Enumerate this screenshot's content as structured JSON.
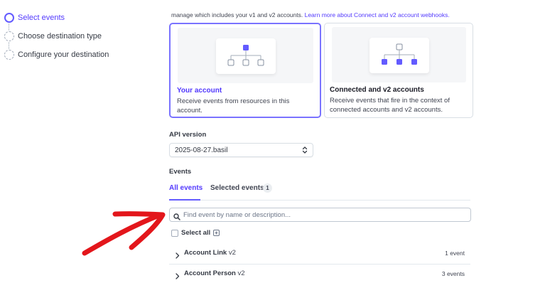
{
  "stepper": {
    "steps": [
      {
        "label": "Select events",
        "active": true
      },
      {
        "label": "Choose destination type",
        "active": false
      },
      {
        "label": "Configure your destination",
        "active": false
      }
    ]
  },
  "intro": {
    "text": "manage which includes your v1 and v2 accounts. ",
    "link": "Learn more about Connect and v2 account webhooks."
  },
  "cards": [
    {
      "title": "Your account",
      "description": "Receive events from resources in this account.",
      "selected": true
    },
    {
      "title": "Connected and v2 accounts",
      "description": "Receive events that fire in the context of connected accounts and v2 accounts.",
      "selected": false
    }
  ],
  "api": {
    "label": "API version",
    "value": "2025-08-27.basil"
  },
  "events": {
    "label": "Events",
    "tabs": {
      "all": "All events",
      "selected": "Selected events",
      "selected_count": "1"
    },
    "search_placeholder": "Find event by name or description...",
    "select_all": "Select all",
    "rows": [
      {
        "name": "Account Link",
        "version": "v2",
        "count": "1 event"
      },
      {
        "name": "Account Person",
        "version": "v2",
        "count": "3 events"
      }
    ]
  },
  "colors": {
    "accent": "#635bff",
    "annotation": "#e3161b"
  },
  "icons": [
    "step-active-icon",
    "step-pending-icon",
    "tree-diagram-icon",
    "select-chevron-icon",
    "search-icon",
    "info-icon",
    "chevron-right-icon",
    "arrow-annotation-icon"
  ]
}
